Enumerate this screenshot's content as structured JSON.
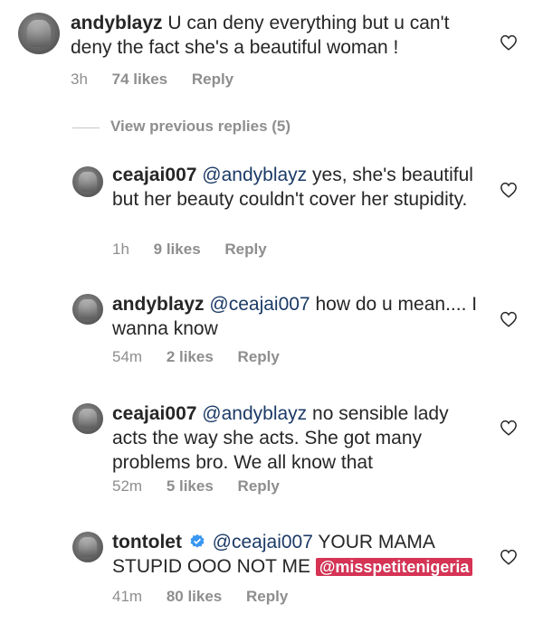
{
  "comments": [
    {
      "username": "andyblayz",
      "text": "U can deny everything but u can't deny the fact she's a beautiful woman !",
      "time": "3h",
      "likes": "74 likes",
      "reply": "Reply"
    },
    {
      "username": "ceajai007",
      "mention": "@andyblayz",
      "text": "yes, she's beautiful but her beauty couldn't cover her stupidity.",
      "time": "1h",
      "likes": "9 likes",
      "reply": "Reply"
    },
    {
      "username": "andyblayz",
      "mention": "@ceajai007",
      "text": "how do u mean.... I wanna know",
      "time": "54m",
      "likes": "2 likes",
      "reply": "Reply"
    },
    {
      "username": "ceajai007",
      "mention": "@andyblayz",
      "text": "no sensible lady acts the way she acts. She got many problems bro. We all know that",
      "time": "52m",
      "likes": "5 likes",
      "reply": "Reply"
    },
    {
      "username": "tontolet",
      "mention": "@ceajai007",
      "text": "YOUR MAMA STUPID OOO NOT ME",
      "overlay_tag": "@misspetitenigeria",
      "time": "41m",
      "likes": "80 likes",
      "reply": "Reply"
    }
  ],
  "view_previous": "View previous replies (5)",
  "icons": {
    "heart": "heart-outline-icon",
    "verified": "verified-badge-icon"
  },
  "colors": {
    "text": "#262626",
    "meta": "#8e8e8e",
    "mention": "#1b3a66",
    "verified": "#3897f0",
    "overlay_tag": "#d63355"
  }
}
